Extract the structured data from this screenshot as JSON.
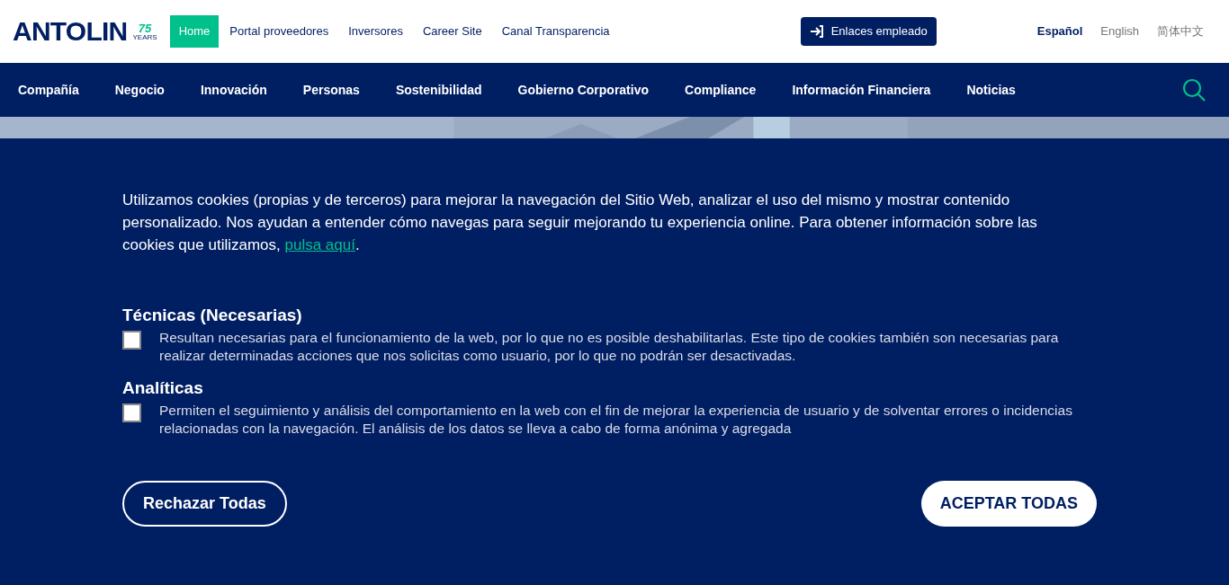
{
  "logo": {
    "name": "ANTOLIN",
    "anniversary": "75",
    "caption": "YEARS"
  },
  "top_links": [
    {
      "label": "Home",
      "selected": true
    },
    {
      "label": "Portal proveedores",
      "selected": false
    },
    {
      "label": "Inversores",
      "selected": false
    },
    {
      "label": "Career Site",
      "selected": false
    },
    {
      "label": "Canal Transparencia",
      "selected": false
    }
  ],
  "employee_button": {
    "label": "Enlaces empleado"
  },
  "languages": [
    {
      "label": "Español",
      "selected": true
    },
    {
      "label": "English",
      "selected": false
    },
    {
      "label": "简体中文",
      "selected": false
    }
  ],
  "nav": [
    "Compañía",
    "Negocio",
    "Innovación",
    "Personas",
    "Sostenibilidad",
    "Gobierno Corporativo",
    "Compliance",
    "Información Financiera",
    "Noticias"
  ],
  "cookie_notice": {
    "text_before": "Utilizamos cookies (propias y de terceros) para mejorar la navegación del Sitio Web, analizar el uso del mismo y mostrar contenido personalizado. Nos ayudan a entender cómo navegas para seguir mejorando tu experiencia online. Para obtener información sobre las cookies que utilizamos, ",
    "link": "pulsa aquí",
    "text_after": ".",
    "categories": [
      {
        "title": "Técnicas (Necesarias)",
        "description": "Resultan necesarias para el funcionamiento de la web, por lo que no es posible deshabilitarlas. Este tipo de cookies también son necesarias para realizar determinadas acciones que nos solicitas como usuario, por lo que no podrán ser desactivadas.",
        "checked": false
      },
      {
        "title": "Analíticas",
        "description": "Permiten el seguimiento y análisis del comportamiento en la web con el fin de mejorar la experiencia de usuario y de solventar errores o incidencias relacionadas con la navegación. El análisis de los datos se lleva a cabo de forma anónima y agregada",
        "checked": false
      }
    ],
    "reject_button": "Rechazar Todas",
    "accept_button": "ACEPTAR TODAS"
  }
}
